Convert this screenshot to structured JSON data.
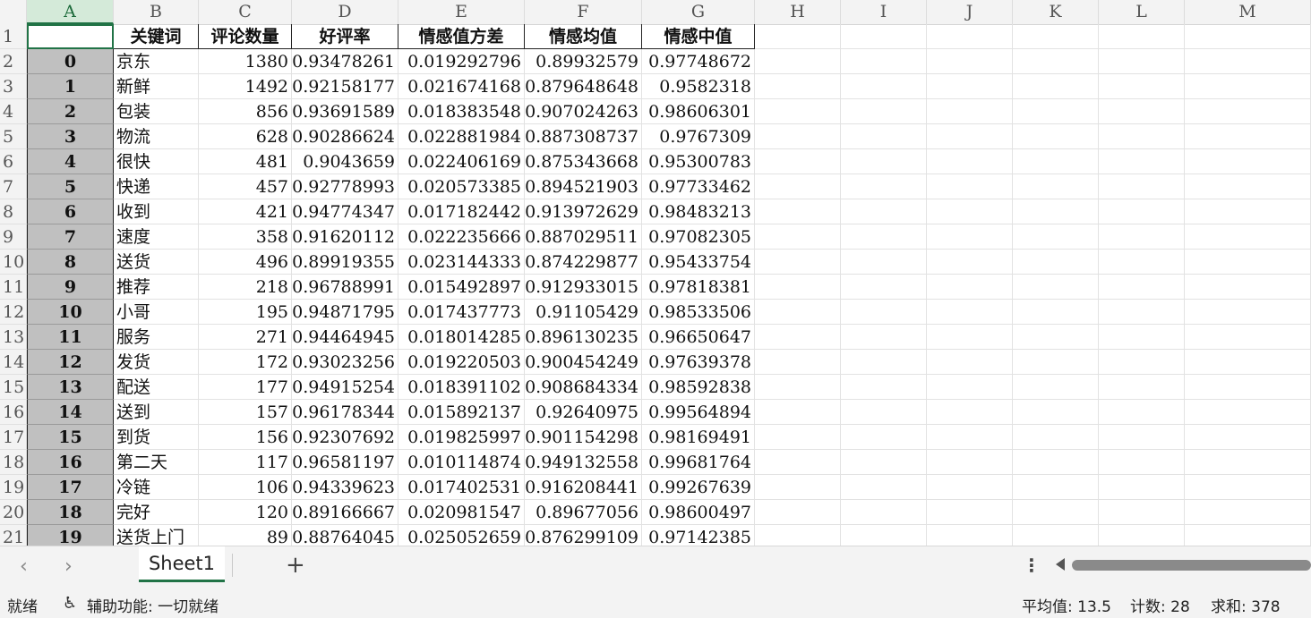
{
  "columns": [
    "A",
    "B",
    "C",
    "D",
    "E",
    "F",
    "G",
    "H",
    "I",
    "J",
    "K",
    "L",
    "M"
  ],
  "header": [
    "",
    "关键词",
    "评论数量",
    "好评率",
    "情感值方差",
    "情感均值",
    "情感中值"
  ],
  "rows": [
    [
      "0",
      "京东",
      "1380",
      "0.93478261",
      "0.019292796",
      "0.89932579",
      "0.97748672"
    ],
    [
      "1",
      "新鲜",
      "1492",
      "0.92158177",
      "0.021674168",
      "0.879648648",
      "0.9582318"
    ],
    [
      "2",
      "包装",
      "856",
      "0.93691589",
      "0.018383548",
      "0.907024263",
      "0.98606301"
    ],
    [
      "3",
      "物流",
      "628",
      "0.90286624",
      "0.022881984",
      "0.887308737",
      "0.9767309"
    ],
    [
      "4",
      "很快",
      "481",
      "0.9043659",
      "0.022406169",
      "0.875343668",
      "0.95300783"
    ],
    [
      "5",
      "快递",
      "457",
      "0.92778993",
      "0.020573385",
      "0.894521903",
      "0.97733462"
    ],
    [
      "6",
      "收到",
      "421",
      "0.94774347",
      "0.017182442",
      "0.913972629",
      "0.98483213"
    ],
    [
      "7",
      "速度",
      "358",
      "0.91620112",
      "0.022235666",
      "0.887029511",
      "0.97082305"
    ],
    [
      "8",
      "送货",
      "496",
      "0.89919355",
      "0.023144333",
      "0.874229877",
      "0.95433754"
    ],
    [
      "9",
      "推荐",
      "218",
      "0.96788991",
      "0.015492897",
      "0.912933015",
      "0.97818381"
    ],
    [
      "10",
      "小哥",
      "195",
      "0.94871795",
      "0.017437773",
      "0.91105429",
      "0.98533506"
    ],
    [
      "11",
      "服务",
      "271",
      "0.94464945",
      "0.018014285",
      "0.896130235",
      "0.96650647"
    ],
    [
      "12",
      "发货",
      "172",
      "0.93023256",
      "0.019220503",
      "0.900454249",
      "0.97639378"
    ],
    [
      "13",
      "配送",
      "177",
      "0.94915254",
      "0.018391102",
      "0.908684334",
      "0.98592838"
    ],
    [
      "14",
      "送到",
      "157",
      "0.96178344",
      "0.015892137",
      "0.92640975",
      "0.99564894"
    ],
    [
      "15",
      "到货",
      "156",
      "0.92307692",
      "0.019825997",
      "0.901154298",
      "0.98169491"
    ],
    [
      "16",
      "第二天",
      "117",
      "0.96581197",
      "0.010114874",
      "0.949132558",
      "0.99681764"
    ],
    [
      "17",
      "冷链",
      "106",
      "0.94339623",
      "0.017402531",
      "0.916208441",
      "0.99267639"
    ],
    [
      "18",
      "完好",
      "120",
      "0.89166667",
      "0.020981547",
      "0.89677056",
      "0.98600497"
    ],
    [
      "19",
      "送货上门",
      "89",
      "0.88764045",
      "0.025052659",
      "0.876299109",
      "0.97142385"
    ]
  ],
  "tabs": {
    "prev": "‹",
    "next": "›",
    "sheet": "Sheet1",
    "add": "+",
    "more": "⋮"
  },
  "status": {
    "ready": "就绪",
    "accessibility": "辅助功能: 一切就绪",
    "average": "平均值: 13.5",
    "count": "计数: 28",
    "sum": "求和: 378"
  }
}
